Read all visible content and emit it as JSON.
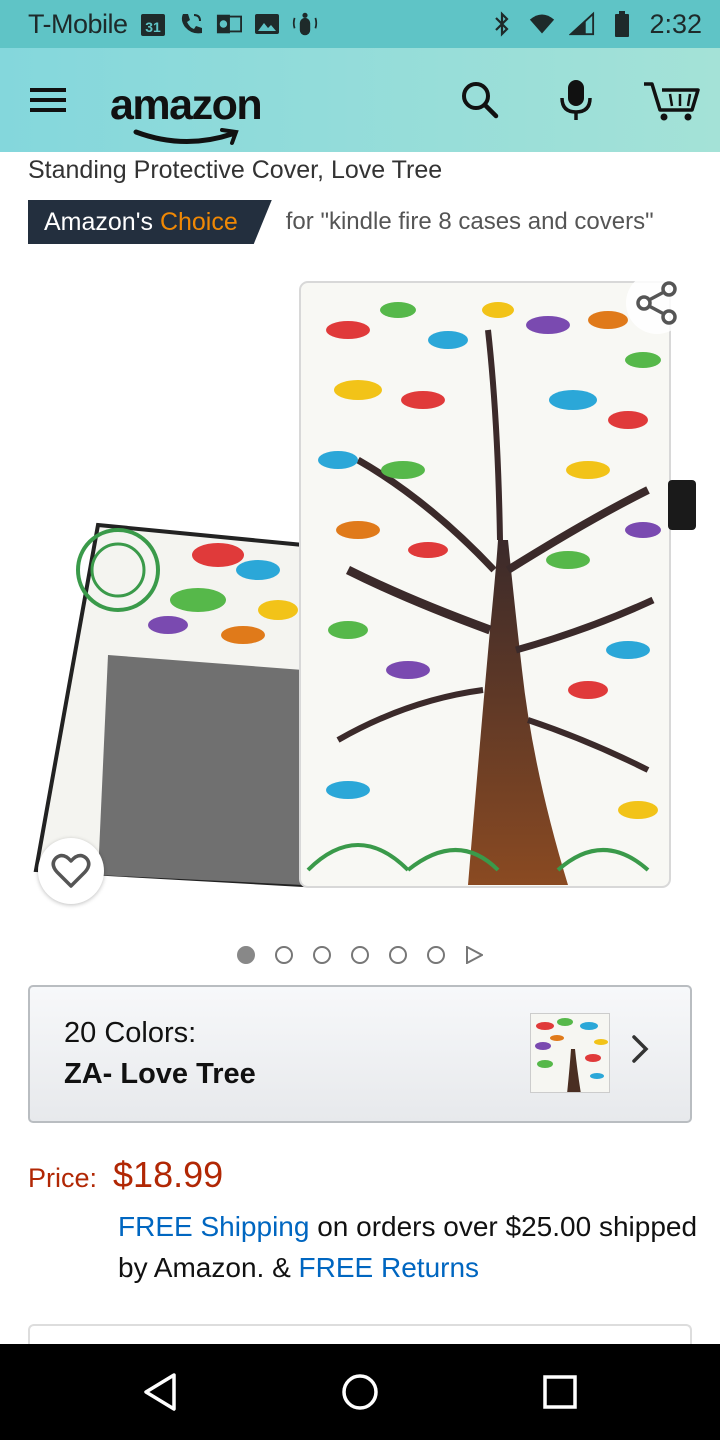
{
  "status_bar": {
    "carrier": "T-Mobile",
    "calendar_day": "31",
    "time": "2:32",
    "icons": [
      "calendar-icon",
      "wifi-calling-icon",
      "outlook-icon",
      "image-icon",
      "accessibility-icon",
      "bluetooth-icon",
      "wifi-icon",
      "signal-icon",
      "battery-icon"
    ]
  },
  "header": {
    "logo_text": "amazon",
    "icons": [
      "menu-icon",
      "search-icon",
      "microphone-icon",
      "cart-icon"
    ]
  },
  "product": {
    "title_fragment": "Standing Protective Cover, Love Tree",
    "badge_prefix": "Amazon's",
    "badge_highlight": "Choice",
    "badge_for": "for \"kindle fire 8 cases and covers\"",
    "image_alt": "Love Tree folio case",
    "carousel": {
      "count": 6,
      "active_index": 0
    }
  },
  "variant": {
    "count_label": "20 Colors:",
    "selected_name": "ZA- Love Tree"
  },
  "pricing": {
    "price_label": "Price:",
    "price_value": "$18.99",
    "free_shipping": "FREE Shipping",
    "shipping_text_1": " on orders over $25.00 shipped by Amazon. & ",
    "free_returns": "FREE Returns"
  },
  "colors": {
    "status_bar": "#5fc4c6",
    "header_start": "#84d7dc",
    "header_end": "#a4e2d7",
    "badge_bg": "#232f3e",
    "badge_accent": "#f08804",
    "price": "#b12704",
    "link": "#0066c0"
  },
  "nav": {
    "icons": [
      "back-icon",
      "home-icon",
      "recents-icon"
    ]
  }
}
